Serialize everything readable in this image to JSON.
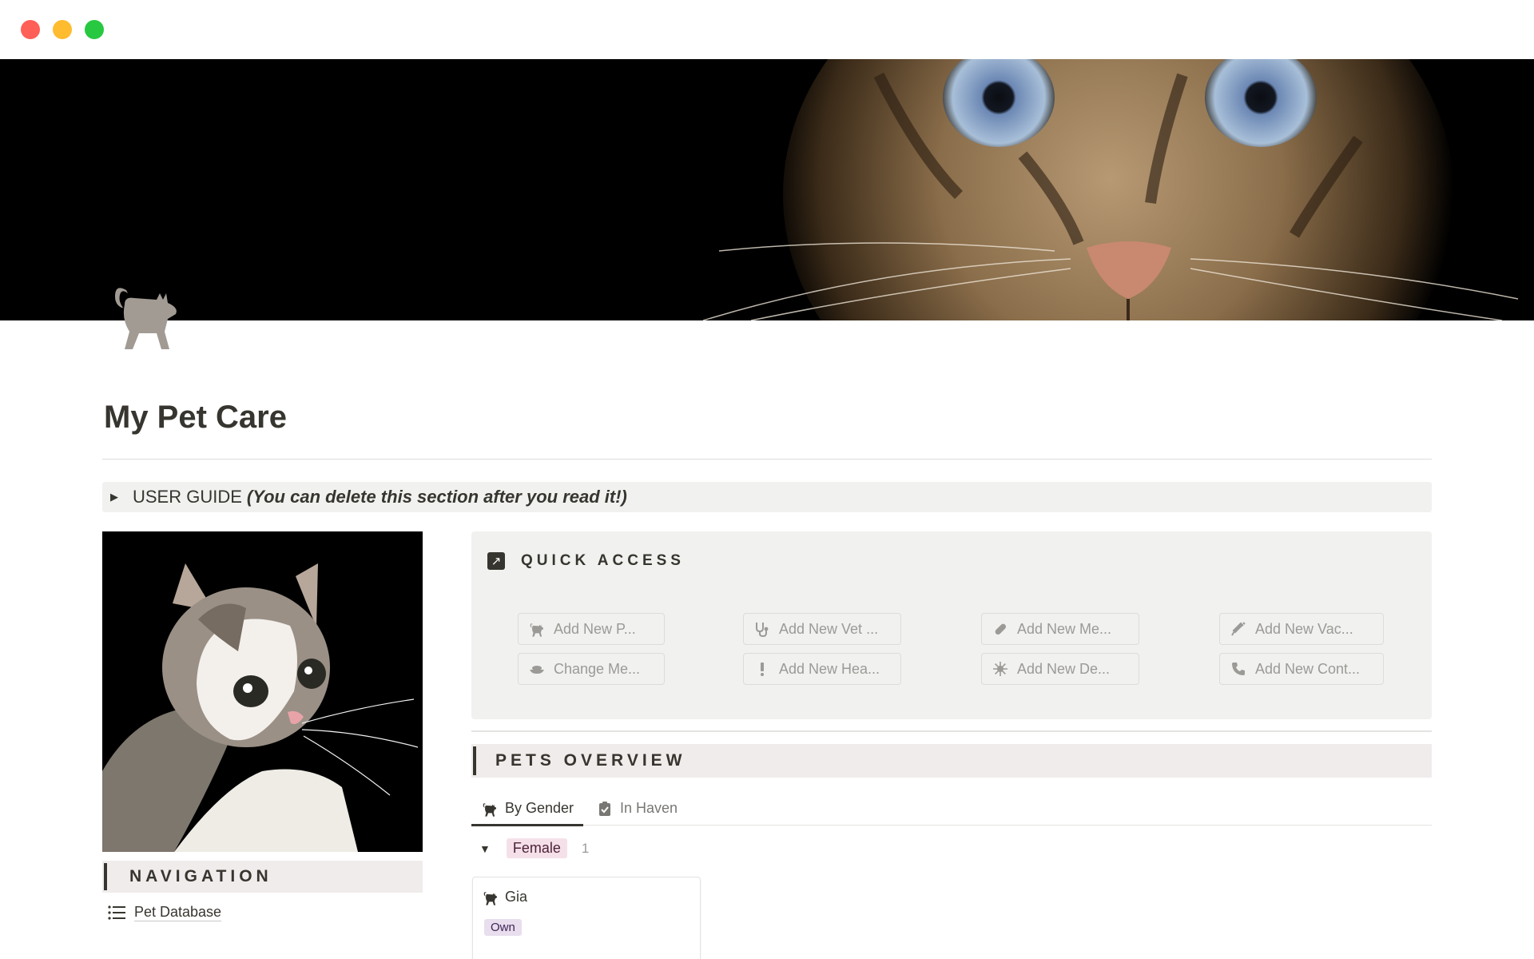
{
  "page": {
    "title": "My Pet Care",
    "icon": "cat-icon"
  },
  "user_guide": {
    "title": "USER GUIDE",
    "subtitle": "(You can delete this section after you read it!)"
  },
  "navigation": {
    "header": "NAVIGATION",
    "items": [
      {
        "label": "Pet Database",
        "icon": "list-icon"
      }
    ]
  },
  "quick_access": {
    "header": "QUICK ACCESS",
    "buttons": [
      {
        "label": "Add New P...",
        "icon": "cat-icon"
      },
      {
        "label": "Add New Vet ...",
        "icon": "stethoscope-icon"
      },
      {
        "label": "Add New Me...",
        "icon": "pill-icon"
      },
      {
        "label": "Add New Vac...",
        "icon": "syringe-icon"
      },
      {
        "label": "Change Me...",
        "icon": "food-bowl-icon"
      },
      {
        "label": "Add New Hea...",
        "icon": "exclamation-icon"
      },
      {
        "label": "Add New De...",
        "icon": "virus-icon"
      },
      {
        "label": "Add New Cont...",
        "icon": "phone-icon"
      }
    ]
  },
  "pets_overview": {
    "header": "PETS OVERVIEW",
    "tabs": [
      {
        "label": "By Gender",
        "icon": "cat-icon",
        "active": true
      },
      {
        "label": "In Haven",
        "icon": "clipboard-icon",
        "active": false
      }
    ],
    "group": {
      "label": "Female",
      "count": "1"
    },
    "cards": [
      {
        "name": "Gia",
        "tag": "Own"
      }
    ]
  },
  "colors": {
    "accent_dark": "#37352f",
    "female_tag_bg": "#f5e0e9",
    "own_tag_bg": "#e8deee",
    "panel_bg": "#f1f1ef"
  }
}
